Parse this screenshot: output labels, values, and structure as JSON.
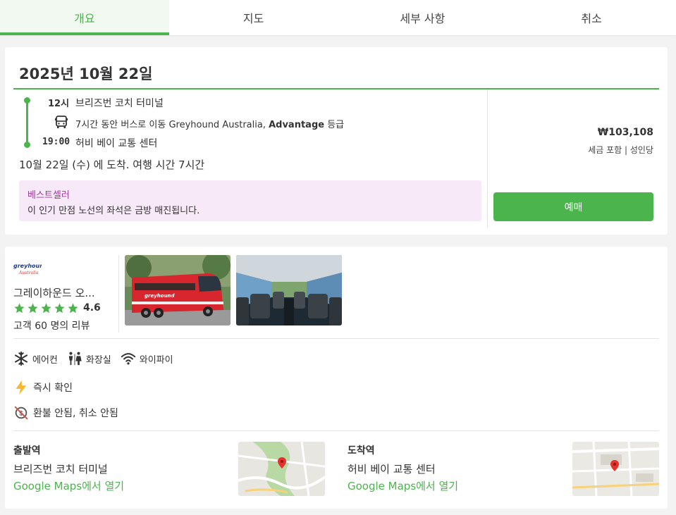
{
  "tabs": [
    {
      "label": "개요"
    },
    {
      "label": "지도"
    },
    {
      "label": "세부 사항"
    },
    {
      "label": "취소"
    }
  ],
  "trip": {
    "date": "2025년 10월 22일",
    "depart_time": "12시",
    "depart_station": "브리즈번 코치 터미널",
    "travel_prefix": "7시간 동안 버스로 이동 Greyhound Australia, ",
    "travel_class": "Advantage",
    "travel_suffix": " 등급",
    "arrive_time": "19:00",
    "arrive_station": "허비 베이 교통 센터",
    "arrival_summary": "10월 22일 (수) 에 도착. 여행 시간 7시간",
    "bestseller_title": "베스트셀러",
    "bestseller_desc": "이 인기 만점 노선의 좌석은 금방 매진됩니다.",
    "price": "₩103,108",
    "price_note": "세금 포함 | 성인당",
    "book_label": "예매"
  },
  "operator": {
    "name": "그레이하운드 오...",
    "rating": "4.6",
    "stars": 5,
    "reviews": "고객 60 명의 리뷰"
  },
  "amenities": [
    {
      "icon": "snowflake-icon",
      "label": "에어컨"
    },
    {
      "icon": "restroom-icon",
      "label": "화장실"
    },
    {
      "icon": "wifi-icon",
      "label": "와이파이"
    }
  ],
  "features": {
    "instant": "즉시 확인",
    "refund": "환불 안됨, 취소 안됨"
  },
  "stations": {
    "departure_label": "출발역",
    "departure_name": "브리즈번 코치 터미널",
    "departure_link": "Google Maps에서 열기",
    "arrival_label": "도착역",
    "arrival_name": "허비 베이 교통 센터",
    "arrival_link": "Google Maps에서 열기"
  },
  "colors": {
    "accent": "#4bb44c",
    "bestseller_bg": "#f8e9f8",
    "bestseller_text": "#9b3b9b",
    "bus_red": "#d7262d"
  }
}
